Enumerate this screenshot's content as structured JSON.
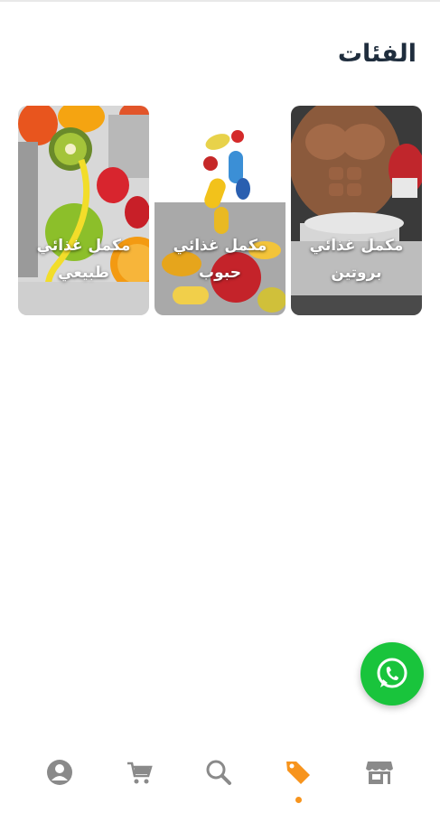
{
  "page": {
    "title": "الفئات"
  },
  "categories": [
    {
      "label": "مكمل غذائي\nبروتين",
      "image": "protein-bodybuilder-image"
    },
    {
      "label": "مكمل غذائي\nحبوب",
      "image": "pills-capsules-image"
    },
    {
      "label": "مكمل غذائي\nطبيعي",
      "image": "fruits-dumbbell-image"
    }
  ],
  "fab": {
    "icon": "whatsapp-icon",
    "color": "#19c43c"
  },
  "bottom_nav": {
    "items": [
      {
        "icon": "profile-icon",
        "active": false
      },
      {
        "icon": "cart-icon",
        "active": false
      },
      {
        "icon": "search-icon",
        "active": false
      },
      {
        "icon": "tag-icon",
        "active": true
      },
      {
        "icon": "store-icon",
        "active": false
      }
    ],
    "active_color": "#f7941d",
    "inactive_color": "#8a8a8a"
  }
}
